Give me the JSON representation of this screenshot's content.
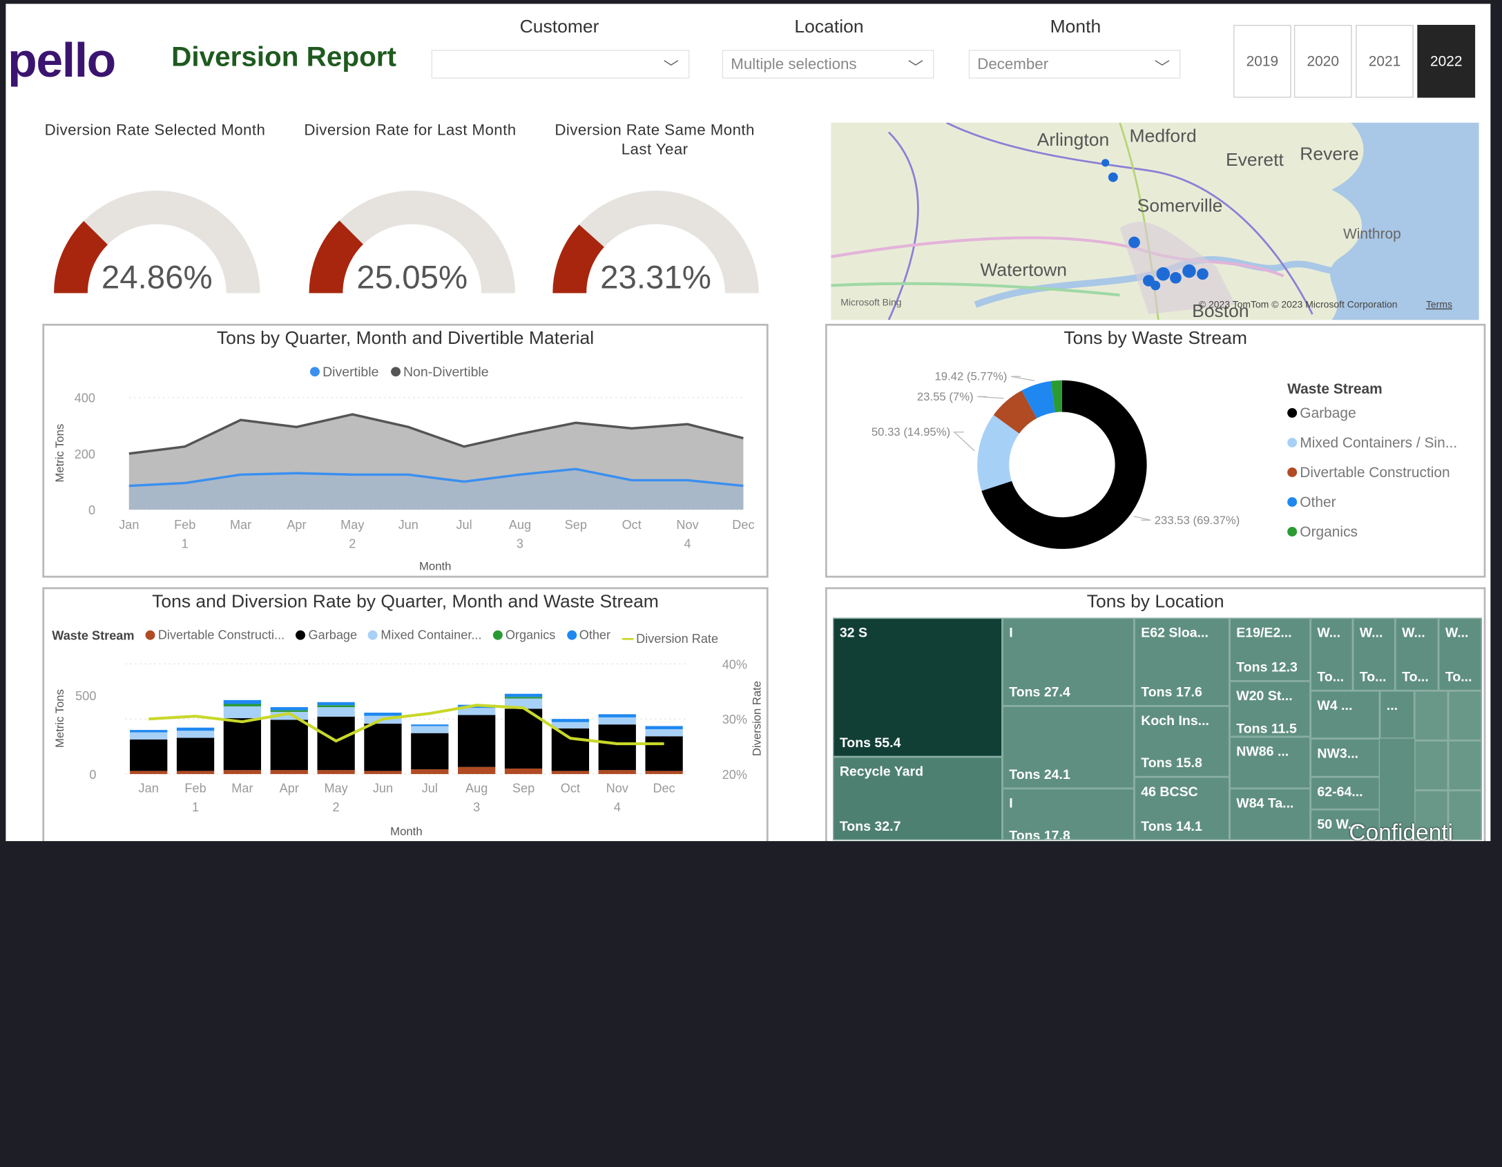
{
  "header": {
    "logo": "pello",
    "title": "Diversion Report"
  },
  "slicers": {
    "customer": {
      "label": "Customer",
      "value": ""
    },
    "location": {
      "label": "Location",
      "value": "Multiple selections"
    },
    "month": {
      "label": "Month",
      "value": "December"
    }
  },
  "years": {
    "options": [
      "2019",
      "2020",
      "2021",
      "2022"
    ],
    "selected": "2022"
  },
  "gauges": [
    {
      "title": "Diversion Rate Selected Month",
      "value_label": "24.86%",
      "value": 24.86
    },
    {
      "title": "Diversion Rate for Last Month",
      "value_label": "25.05%",
      "value": 25.05
    },
    {
      "title": "Diversion Rate Same Month Last Year",
      "value_label": "23.31%",
      "value": 23.31
    }
  ],
  "map": {
    "labels": [
      "Arlington",
      "Medford",
      "Everett",
      "Revere",
      "Somerville",
      "Winthrop",
      "Watertown",
      "Boston"
    ],
    "attribution": "© 2023 TomTom © 2023 Microsoft Corporation",
    "terms": "Terms",
    "brand": "Microsoft Bing",
    "colors": {
      "water": "#a9c7e6",
      "land": "#e8ecd7",
      "pin": "#1e6bd6"
    }
  },
  "area_chart": {
    "title": "Tons by Quarter, Month and Divertible Material",
    "legend": [
      "Divertible",
      "Non-Divertible"
    ],
    "ylabel": "Metric Tons",
    "xlabel": "Month",
    "colors": {
      "divertible": "#3a8ff0",
      "non_divertible": "#555555"
    },
    "chart_data": {
      "type": "area",
      "categories": [
        "Jan",
        "Feb",
        "Mar",
        "Apr",
        "May",
        "Jun",
        "Jul",
        "Aug",
        "Sep",
        "Oct",
        "Nov",
        "Dec"
      ],
      "quarters": [
        "1",
        "2",
        "3",
        "4"
      ],
      "series": [
        {
          "name": "Divertible",
          "values": [
            85,
            95,
            125,
            130,
            125,
            125,
            100,
            125,
            145,
            105,
            105,
            85
          ]
        },
        {
          "name": "Non-Divertible",
          "values": [
            200,
            225,
            320,
            295,
            340,
            295,
            225,
            270,
            310,
            290,
            305,
            255
          ]
        }
      ],
      "yticks": [
        "0",
        "200",
        "400"
      ],
      "ylim": [
        0,
        400
      ]
    }
  },
  "donut": {
    "title": "Tons by Waste Stream",
    "legend_title": "Waste Stream",
    "legend": [
      "Garbage",
      "Mixed Containers / Sin...",
      "Divertable Construction",
      "Other",
      "Organics"
    ],
    "chart_data": {
      "type": "pie",
      "labels": [
        "Garbage",
        "Mixed Containers / Sin...",
        "Divertable Construction",
        "Other",
        "Organics"
      ],
      "values": [
        233.53,
        50.33,
        23.55,
        19.42,
        7.0
      ],
      "data_labels": [
        "233.53 (69.37%)",
        "50.33 (14.95%)",
        "23.55 (7%)",
        "19.42 (5.77%)",
        ""
      ],
      "colors": [
        "#000000",
        "#a7d0f7",
        "#b04b23",
        "#1e88f0",
        "#2a9a32"
      ]
    }
  },
  "combo_chart": {
    "title": "Tons and Diversion Rate by Quarter, Month and Waste Stream",
    "legend_title": "Waste Stream",
    "legend": [
      "Divertable Constructi...",
      "Garbage",
      "Mixed Container...",
      "Organics",
      "Other",
      "Diversion Rate"
    ],
    "ylabel": "Metric Tons",
    "y2label": "Diversion Rate",
    "xlabel": "Month",
    "yticks": [
      "0",
      "500"
    ],
    "y2ticks": [
      "20%",
      "30%",
      "40%"
    ],
    "chart_data": {
      "type": "bar",
      "categories": [
        "Jan",
        "Feb",
        "Mar",
        "Apr",
        "May",
        "Jun",
        "Jul",
        "Aug",
        "Sep",
        "Oct",
        "Nov",
        "Dec"
      ],
      "quarters": [
        "1",
        "2",
        "3",
        "4"
      ],
      "ylim": [
        0,
        700
      ],
      "y2lim": [
        20,
        40
      ],
      "series": [
        {
          "name": "Divertable Constructi...",
          "color": "#b04b23",
          "values": [
            20,
            20,
            25,
            25,
            25,
            20,
            30,
            45,
            35,
            20,
            25,
            20
          ]
        },
        {
          "name": "Garbage",
          "color": "#000000",
          "values": [
            200,
            210,
            330,
            320,
            340,
            300,
            230,
            330,
            380,
            270,
            290,
            220
          ]
        },
        {
          "name": "Mixed Container...",
          "color": "#a7d0f7",
          "values": [
            45,
            45,
            75,
            50,
            60,
            50,
            45,
            45,
            65,
            40,
            45,
            45
          ]
        },
        {
          "name": "Organics",
          "color": "#2a9a32",
          "values": [
            0,
            0,
            15,
            10,
            12,
            0,
            0,
            0,
            10,
            0,
            0,
            0
          ]
        },
        {
          "name": "Other",
          "color": "#1e88f0",
          "values": [
            15,
            20,
            25,
            20,
            20,
            20,
            10,
            20,
            20,
            20,
            20,
            20
          ]
        },
        {
          "name": "Diversion Rate",
          "color": "#c8d82a",
          "values": [
            30,
            30.5,
            29.5,
            31,
            26,
            30,
            31,
            32.5,
            32,
            26.5,
            25.5,
            25.5
          ]
        }
      ]
    }
  },
  "treemap": {
    "title": "Tons by Location",
    "tiles": [
      {
        "name": "32 S",
        "value_label": "Tons 55.4"
      },
      {
        "name": "Recycle Yard",
        "value_label": "Tons 32.7"
      },
      {
        "name": "I",
        "value_label": "Tons 27.4"
      },
      {
        "name": "",
        "value_label": "Tons 24.1"
      },
      {
        "name": "I",
        "value_label": "Tons 17.8"
      },
      {
        "name": "E62 Sloa...",
        "value_label": "Tons 17.6"
      },
      {
        "name": "Koch Ins...",
        "value_label": "Tons 15.8"
      },
      {
        "name": "46 BCSC",
        "value_label": "Tons 14.1"
      },
      {
        "name": "E19/E2...",
        "value_label": "Tons 12.3"
      },
      {
        "name": "W20 St...",
        "value_label": "Tons 11.5"
      },
      {
        "name": "NW86 ...",
        "value_label": ""
      },
      {
        "name": "W84 Ta...",
        "value_label": ""
      },
      {
        "name": "W...",
        "value_label": "To..."
      },
      {
        "name": "W...",
        "value_label": "To..."
      },
      {
        "name": "W...",
        "value_label": "To..."
      },
      {
        "name": "W...",
        "value_label": "To..."
      },
      {
        "name": "W4 ...",
        "value_label": ""
      },
      {
        "name": "...",
        "value_label": ""
      },
      {
        "name": "NW3...",
        "value_label": ""
      },
      {
        "name": "62-64...",
        "value_label": ""
      },
      {
        "name": "50 W...",
        "value_label": ""
      }
    ]
  },
  "watermark": "Confidenti"
}
